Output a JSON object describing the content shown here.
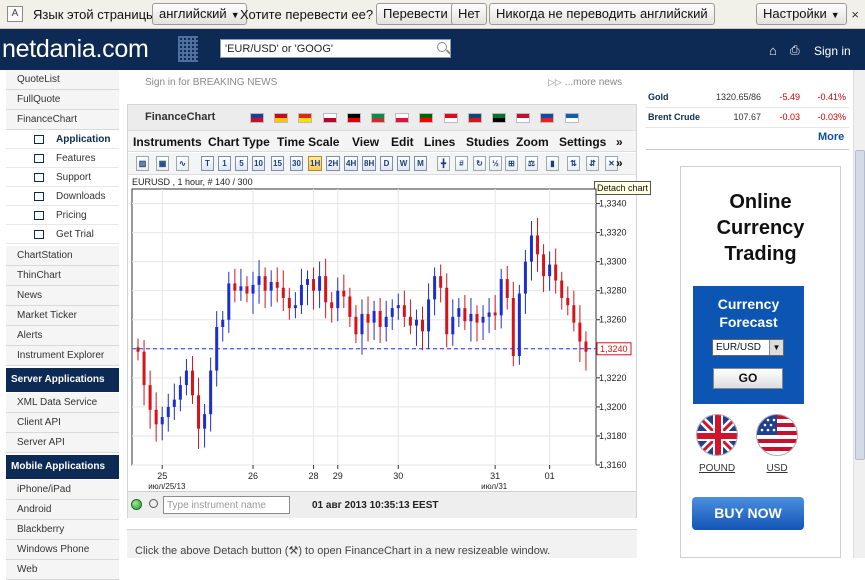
{
  "translate_bar": {
    "prompt": "Язык этой страницы",
    "language": "английский",
    "question": "Хотите перевести ее?",
    "translate": "Перевести",
    "no": "Нет",
    "never": "Никогда не переводить английский",
    "settings": "Настройки",
    "close": "×"
  },
  "header": {
    "logo": "netdania.com",
    "search_value": "'EUR/USD' or 'GOOG'",
    "signin": "Sign in"
  },
  "sidebar": {
    "items_top": [
      "QuoteList",
      "FullQuote",
      "FinanceChart"
    ],
    "sub_items": [
      "Application",
      "Features",
      "Support",
      "Downloads",
      "Pricing",
      "Get Trial"
    ],
    "items_mid": [
      "ChartStation",
      "ThinChart",
      "News",
      "Market Ticker",
      "Alerts",
      "Instrument Explorer"
    ],
    "server_head": "Server Applications",
    "server_items": [
      "XML Data Service",
      "Client API",
      "Server API"
    ],
    "mobile_head": "Mobile Applications",
    "mobile_items": [
      "iPhone/iPad",
      "Android",
      "Blackberry",
      "Windows Phone",
      "Web"
    ]
  },
  "news": {
    "signin": "Sign in for BREAKING NEWS",
    "more": "...more news"
  },
  "financechart": {
    "title": "FinanceChart",
    "menu": [
      "Instruments",
      "Chart Type",
      "Time Scale",
      "View",
      "Edit",
      "Lines",
      "Studies",
      "Zoom",
      "Settings",
      "»"
    ],
    "timescales": [
      "T",
      "1",
      "5",
      "10",
      "15",
      "30",
      "1H",
      "2H",
      "4H",
      "8H",
      "D",
      "W",
      "M"
    ],
    "selected_timescale": "1H",
    "symbol_info": "EURUSD , 1 hour, # 140 / 300",
    "tooltip": "Detach chart",
    "instrument_placeholder": "Type instrument name",
    "status_time": "01 авг 2013 10:35:13 EEST"
  },
  "chart_data": {
    "type": "candlestick",
    "ylim": [
      1.316,
      1.335
    ],
    "y_ticks": [
      "1,3160",
      "1,3180",
      "1,3200",
      "1,3220",
      "1,3240",
      "1,3260",
      "1,3280",
      "1,3300",
      "1,3320",
      "1,3340"
    ],
    "x_ticks": [
      {
        "label": "25",
        "sub": "июл/25/13",
        "idx": 4
      },
      {
        "label": "26",
        "sub": "",
        "idx": 19
      },
      {
        "label": "28",
        "sub": "",
        "idx": 29
      },
      {
        "label": "29",
        "sub": "",
        "idx": 33
      },
      {
        "label": "30",
        "sub": "",
        "idx": 43
      },
      {
        "label": "31",
        "sub": "июл/31",
        "idx": 59
      },
      {
        "label": "01",
        "sub": "",
        "idx": 68
      }
    ],
    "last_price": 1.324,
    "last_price_label": "1,3240",
    "closes": [
      1.3238,
      1.3215,
      1.3198,
      1.3188,
      1.3193,
      1.32,
      1.3205,
      1.3215,
      1.3225,
      1.3208,
      1.3185,
      1.3195,
      1.3225,
      1.3255,
      1.326,
      1.3285,
      1.328,
      1.3283,
      1.3278,
      1.3284,
      1.329,
      1.328,
      1.3286,
      1.3282,
      1.3275,
      1.3268,
      1.327,
      1.3284,
      1.3288,
      1.328,
      1.329,
      1.3272,
      1.3268,
      1.328,
      1.3276,
      1.3262,
      1.325,
      1.3264,
      1.3258,
      1.3266,
      1.3255,
      1.3262,
      1.3268,
      1.327,
      1.3262,
      1.3256,
      1.326,
      1.3252,
      1.3274,
      1.329,
      1.3282,
      1.325,
      1.3262,
      1.3268,
      1.3259,
      1.3264,
      1.3258,
      1.3262,
      1.3265,
      1.3263,
      1.3288,
      1.3275,
      1.3235,
      1.3278,
      1.33,
      1.3318,
      1.3305,
      1.329,
      1.3298,
      1.3287,
      1.3275,
      1.327,
      1.3258,
      1.3245,
      1.3238
    ]
  },
  "detach_note": "Click the above Detach button (⚒) to open FinanceChart in a new resizeable window.",
  "market": [
    {
      "name": "Gold",
      "value": "1320.65/86",
      "change": "-5.49",
      "pct": "-0.41%"
    },
    {
      "name": "Brent Crude",
      "value": "107.67",
      "change": "-0.03",
      "pct": "-0.03%"
    }
  ],
  "market_more": "More",
  "ad": {
    "title_lines": [
      "Online",
      "Currency",
      "Trading"
    ],
    "forecast_lines": [
      "Currency",
      "Forecast"
    ],
    "select_value": "EUR/USD",
    "go": "GO",
    "pound": "POUND",
    "usd": "USD",
    "buy": "BUY NOW"
  }
}
